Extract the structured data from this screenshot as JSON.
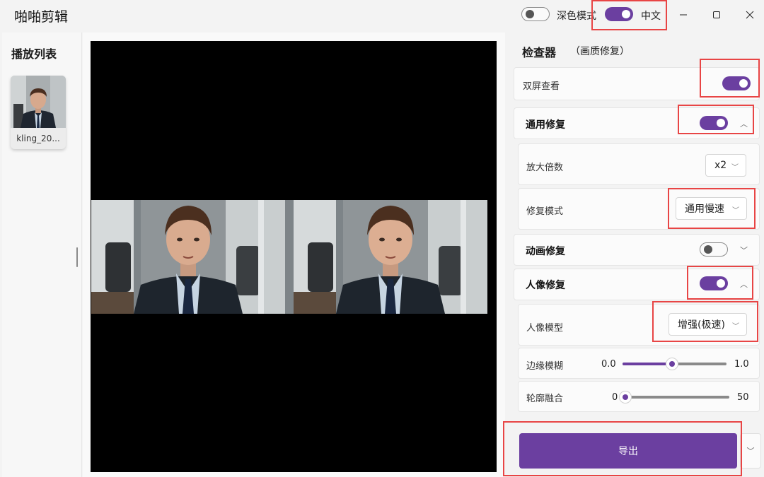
{
  "app": {
    "title": "啪啪剪辑"
  },
  "titlebar": {
    "dark_mode_label": "深色模式",
    "dark_mode_on": false,
    "language_label": "中文",
    "language_on": true,
    "minimize_icon": "minimize-icon",
    "maximize_icon": "maximize-icon",
    "close_icon": "close-icon"
  },
  "playlist": {
    "title": "播放列表",
    "items": [
      {
        "name": "kling_20..."
      }
    ]
  },
  "inspector": {
    "title": "检查器",
    "subtitle": "（画质修复）",
    "dual_screen": {
      "label": "双屏查看",
      "on": true
    },
    "general_repair": {
      "label": "通用修复",
      "on": true,
      "expanded": true,
      "scale": {
        "label": "放大倍数",
        "value": "x2"
      },
      "mode": {
        "label": "修复模式",
        "value": "通用慢速"
      }
    },
    "anime_repair": {
      "label": "动画修复",
      "on": false,
      "expanded": false
    },
    "portrait_repair": {
      "label": "人像修复",
      "on": true,
      "expanded": true,
      "model": {
        "label": "人像模型",
        "value": "增强(极速)"
      },
      "edge_blur": {
        "label": "边缘模糊",
        "min": "0.0",
        "max": "1.0",
        "value": 0.5
      },
      "contour_blend": {
        "label": "轮廓融合",
        "min": "0",
        "max": "50",
        "value": 0
      }
    },
    "export_label": "导出"
  },
  "colors": {
    "accent": "#6b3fa0",
    "highlight": "#e84545"
  }
}
